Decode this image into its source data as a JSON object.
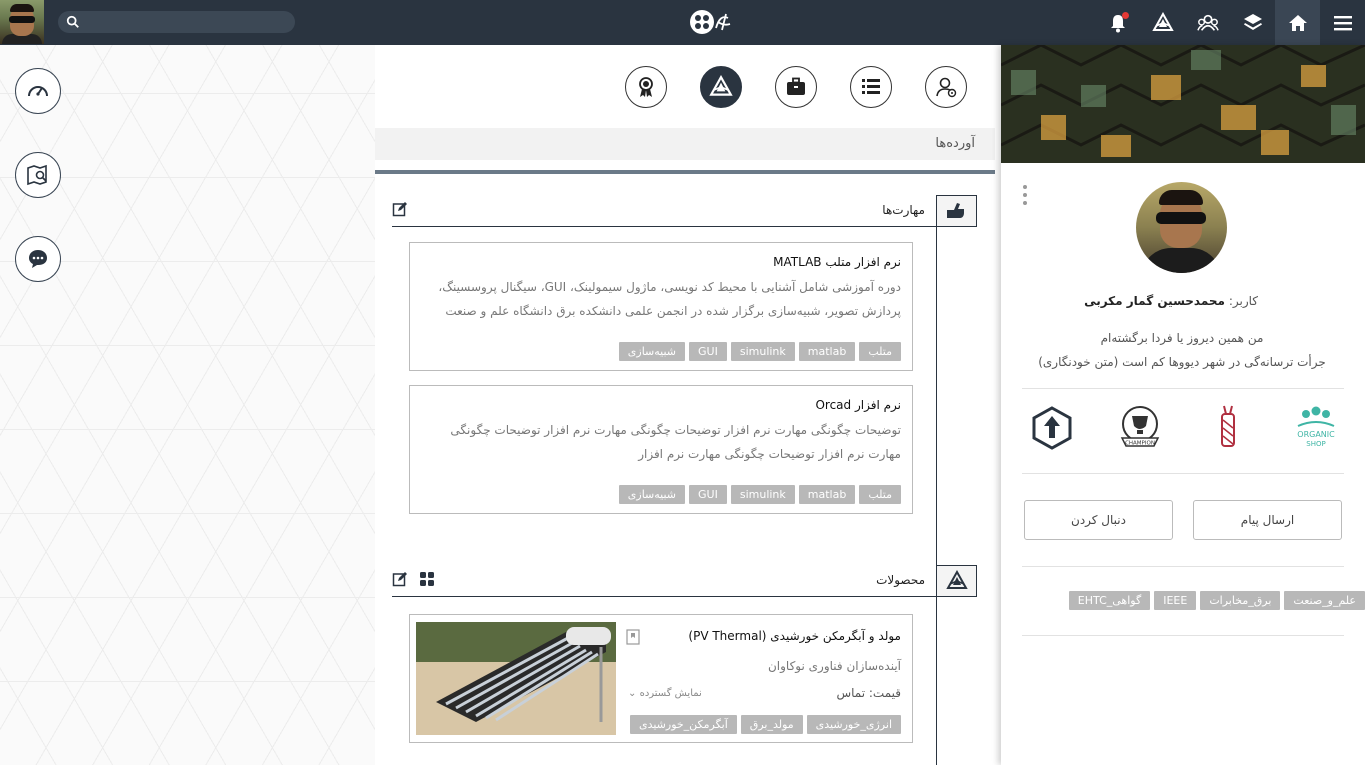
{
  "topbar": {
    "search_placeholder": "",
    "icons": [
      "menu-icon",
      "home-icon",
      "layers-icon",
      "group-icon",
      "brand-icon",
      "bell-icon"
    ]
  },
  "left_actions": [
    "dashboard-gauge-icon",
    "map-search-icon",
    "chat-bubble-icon"
  ],
  "tabs": [
    "profile-user-icon",
    "list-icon",
    "briefcase-icon",
    "brand-icon",
    "award-icon"
  ],
  "section_header": "آورده‌ها",
  "skills": {
    "title": "مهارت‌ها",
    "items": [
      {
        "title": "نرم افزار متلب MATLAB",
        "desc": "دوره آموزشی شامل آشنایی با محیط کد نویسی، ماژول سیمولینک، GUI، سیگنال پروسسینگ، پردازش تصویر، شبیه‌سازی برگزار شده در انجمن علمی دانشکده برق دانشگاه علم و صنعت",
        "tags": [
          "متلب",
          "matlab",
          "simulink",
          "GUI",
          "شبیه‌سازی"
        ]
      },
      {
        "title": "نرم افزار Orcad",
        "desc": "توضیحات چگونگی مهارت نرم افزار توضیحات چگونگی مهارت نرم افزار توضیحات چگونگی مهارت نرم افزار توضیحات چگونگی مهارت نرم افزار",
        "tags": [
          "متلب",
          "matlab",
          "simulink",
          "GUI",
          "شبیه‌سازی"
        ]
      }
    ]
  },
  "products": {
    "title": "محصولات",
    "items": [
      {
        "title": "مولد و آبگرمکن خورشیدی (PV Thermal)",
        "company": "آینده‌سازان فناوری نوکاوان",
        "price": "قیمت: تماس",
        "expand": "نمایش گسترده",
        "tags": [
          "انرژی_خورشیدی",
          "مولد_برق",
          "آبگرمکن_خورشیدی"
        ]
      }
    ]
  },
  "profile": {
    "user_label": "کاربر:",
    "user_name": "محمدحسین گمار مکربی",
    "bio_line1": "من همین دیروز یا فردا برگشته‌ام",
    "bio_line2": "جرأت ترسانه‌گی در شهر دیووها کم است (متن خودنگاری)",
    "send_message": "ارسال پیام",
    "follow": "دنبال کردن",
    "tags": [
      "علم_و_صنعت",
      "برق_مخابرات",
      "IEEE",
      "گواهی_EHTC"
    ],
    "logos": [
      "organic-shop-logo",
      "bottle-logo",
      "champion-logo",
      "upload-arrow-logo"
    ],
    "organic_text": "ORGANIC",
    "shop_text": "SHOP",
    "champion_text": "CHAMPION"
  },
  "colors": {
    "topbar": "#2a3440",
    "tag_bg": "#b8b8b8",
    "organic": "#3fb5a5"
  }
}
